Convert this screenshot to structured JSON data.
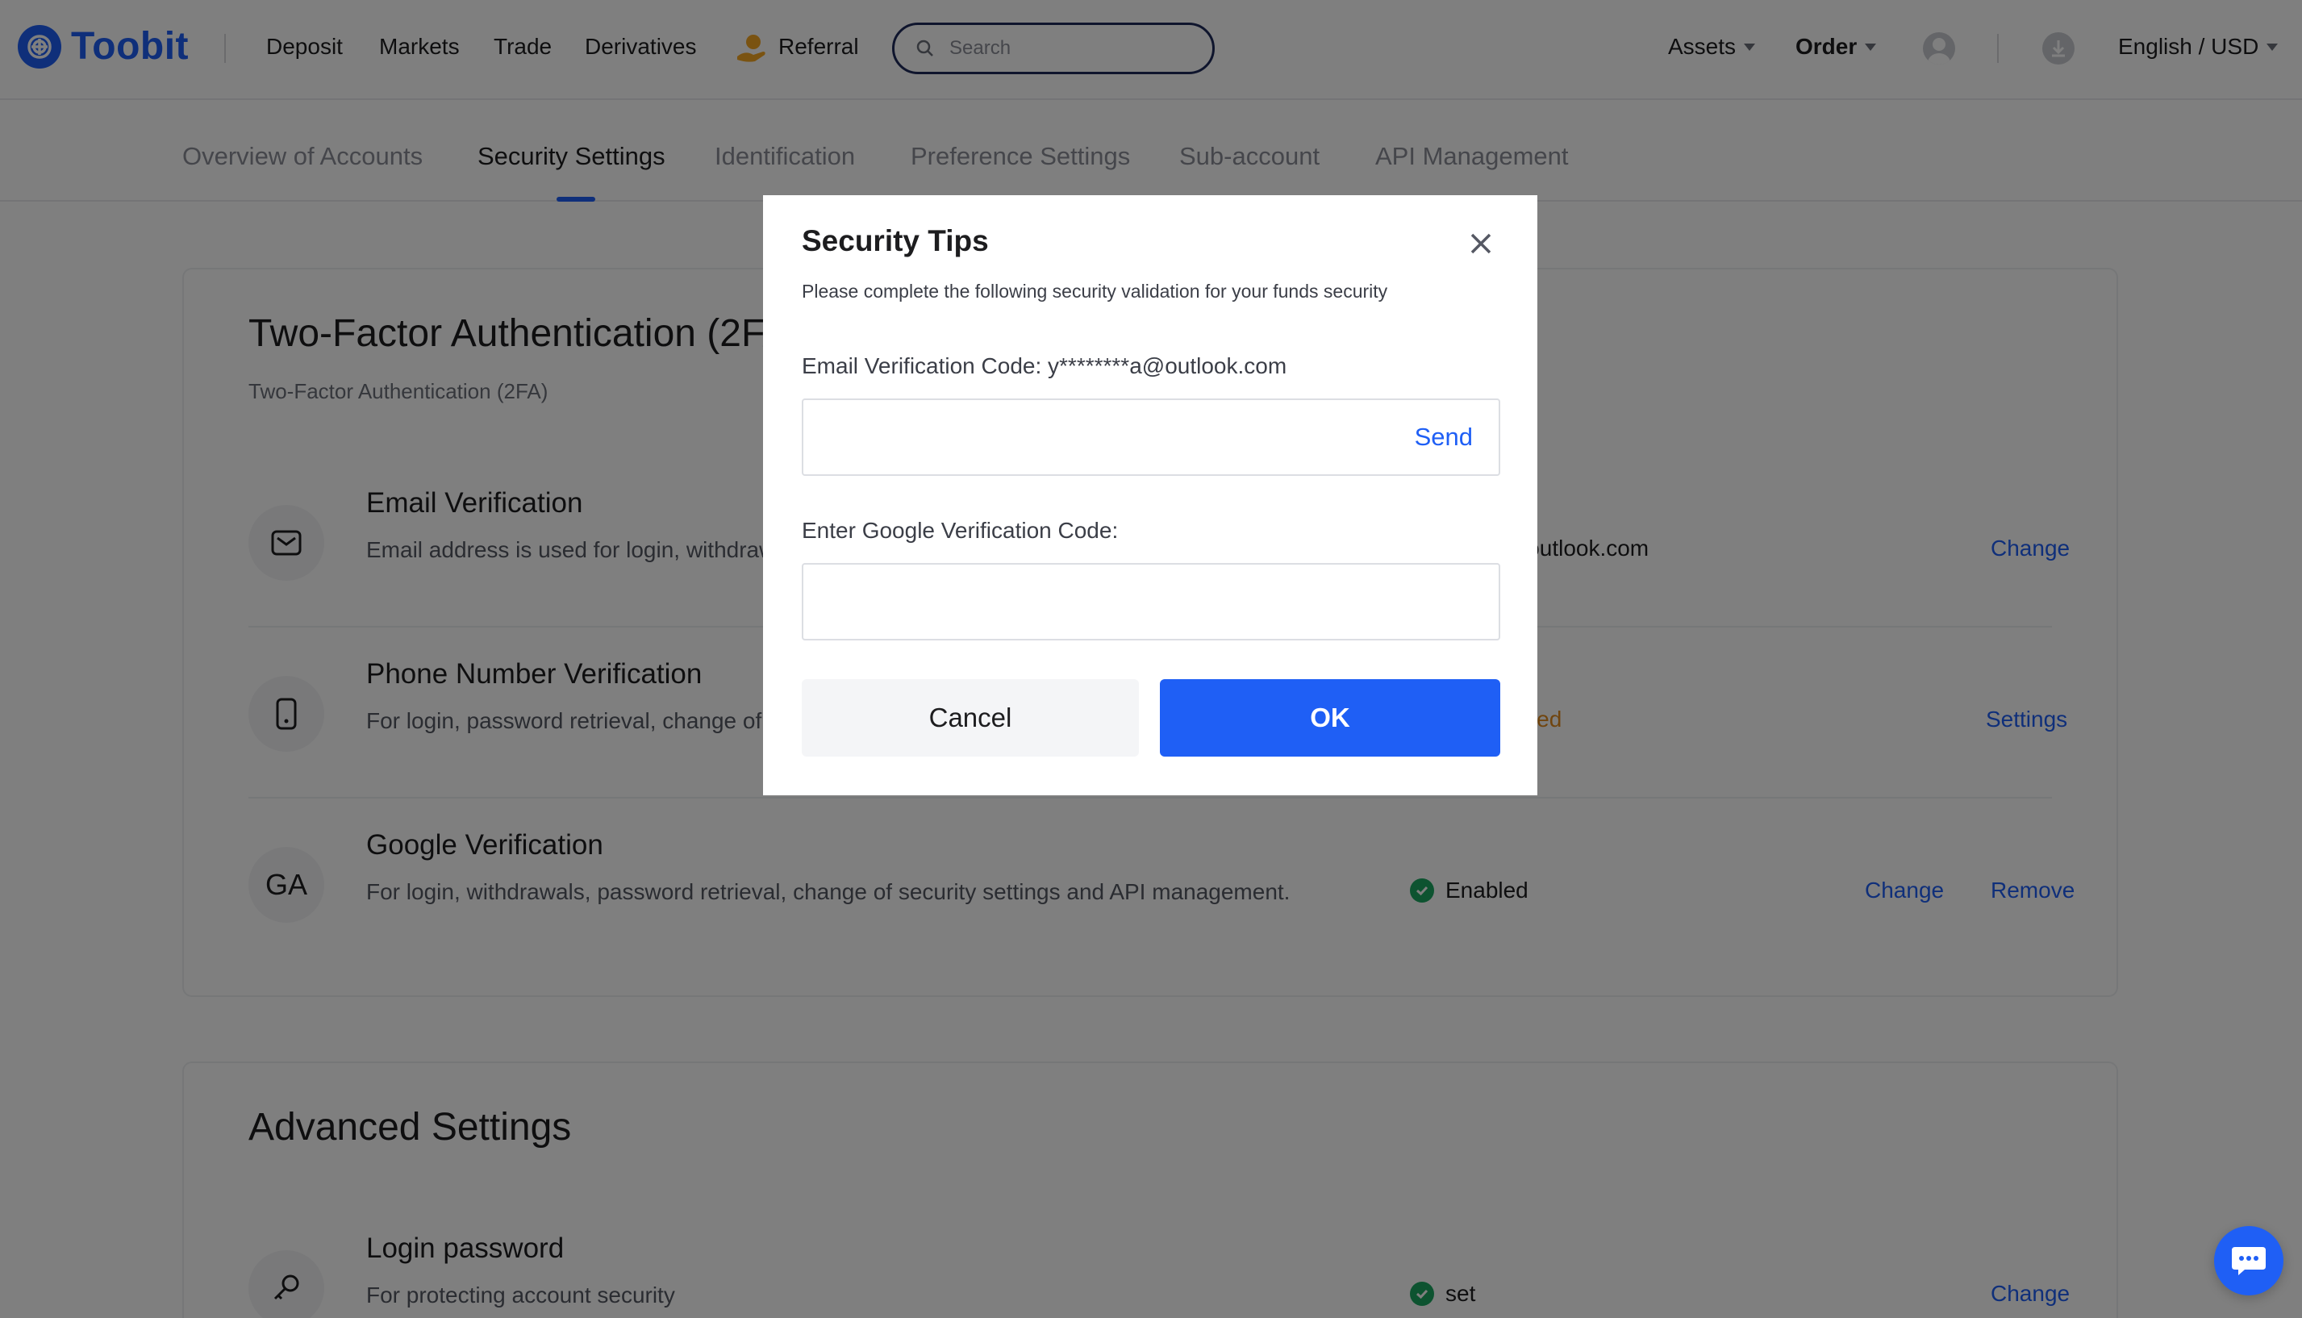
{
  "brand": {
    "name": "Toobit",
    "color": "#1f5ff5"
  },
  "nav": {
    "links": [
      "Deposit",
      "Markets",
      "Trade",
      "Derivatives",
      "Referral"
    ],
    "search_placeholder": "Search",
    "assets": "Assets",
    "order": "Order",
    "language": "English / USD"
  },
  "tabs": [
    "Overview of Accounts",
    "Security Settings",
    "Identification",
    "Preference Settings",
    "Sub-account",
    "API Management"
  ],
  "two_factor": {
    "title": "Two-Factor Authentication (2FA)",
    "subtitle": "Two-Factor Authentication (2FA)",
    "rows": [
      {
        "title": "Email Verification",
        "desc": "Email address is used for login, withdrawals, password retrieval, change of security settings and API management.",
        "status": "y********a@outlook.com",
        "action": "Change"
      },
      {
        "title": "Phone Number Verification",
        "desc": "For login, password retrieval, change of security settings and API management.",
        "status": "Not Configured",
        "action": "Settings"
      },
      {
        "icon_text": "GA",
        "title": "Google Verification",
        "desc": "For login, withdrawals, password retrieval, change of security settings and API management.",
        "status": "Enabled",
        "action1": "Change",
        "action2": "Remove"
      }
    ]
  },
  "advanced": {
    "title": "Advanced Settings",
    "rows": [
      {
        "title": "Login password",
        "desc": "For protecting account security",
        "status": "set",
        "action": "Change"
      }
    ]
  },
  "modal": {
    "title": "Security Tips",
    "subtitle": "Please complete the following security validation for your funds security",
    "email_label": "Email Verification Code: y********a@outlook.com",
    "send": "Send",
    "google_label": "Enter Google Verification Code:",
    "cancel": "Cancel",
    "ok": "OK"
  },
  "colors": {
    "primary": "#1f5ff5",
    "success": "#1aa760",
    "warning": "#e08a1e",
    "overlay": "rgba(0,0,0,0.5)"
  }
}
